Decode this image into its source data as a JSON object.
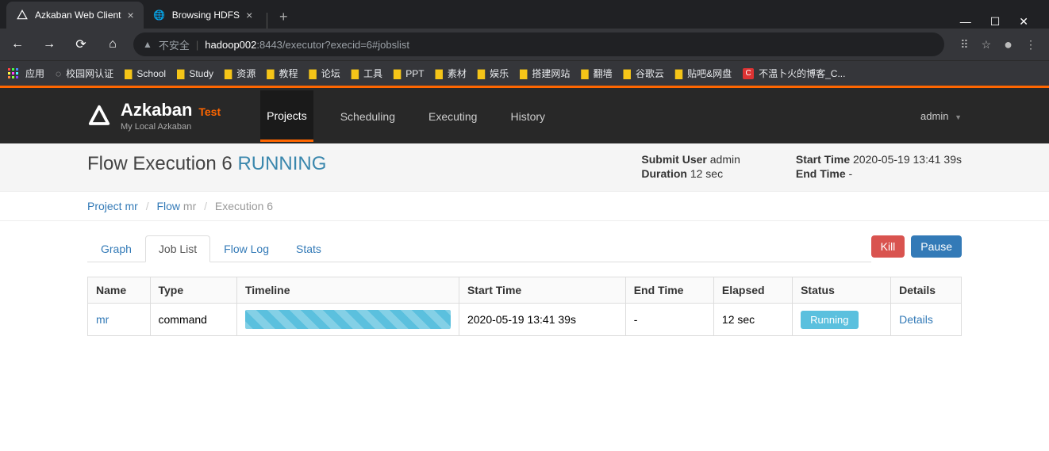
{
  "browser": {
    "tabs": [
      {
        "title": "Azkaban Web Client",
        "active": true
      },
      {
        "title": "Browsing HDFS",
        "active": false
      }
    ],
    "url_insecure_label": "不安全",
    "url_host": "hadoop002",
    "url_port": ":8443",
    "url_path": "/executor?execid=6#jobslist",
    "bookmarks_label_apps": "应用",
    "bookmarks": [
      {
        "label": "校园网认证",
        "icon": "globe"
      },
      {
        "label": "School",
        "icon": "folder"
      },
      {
        "label": "Study",
        "icon": "folder"
      },
      {
        "label": "资源",
        "icon": "folder"
      },
      {
        "label": "教程",
        "icon": "folder"
      },
      {
        "label": "论坛",
        "icon": "folder"
      },
      {
        "label": "工具",
        "icon": "folder"
      },
      {
        "label": "PPT",
        "icon": "folder"
      },
      {
        "label": "素材",
        "icon": "folder"
      },
      {
        "label": "娱乐",
        "icon": "folder"
      },
      {
        "label": "搭建网站",
        "icon": "folder"
      },
      {
        "label": "翻墙",
        "icon": "folder"
      },
      {
        "label": "谷歌云",
        "icon": "folder"
      },
      {
        "label": "贴吧&网盘",
        "icon": "folder"
      },
      {
        "label": "不温卜火的博客_C...",
        "icon": "red"
      }
    ]
  },
  "az": {
    "brand": "Azkaban",
    "brand_sub": "Test",
    "tagline": "My Local Azkaban",
    "menu": {
      "projects": "Projects",
      "scheduling": "Scheduling",
      "executing": "Executing",
      "history": "History"
    },
    "user": "admin"
  },
  "page": {
    "title_prefix": "Flow Execution ",
    "exec_id": "6",
    "status": "RUNNING",
    "meta": {
      "submit_user_label": "Submit User",
      "submit_user": "admin",
      "duration_label": "Duration",
      "duration": "12 sec",
      "start_time_label": "Start Time",
      "start_time": "2020-05-19 13:41 39s",
      "end_time_label": "End Time",
      "end_time": "-"
    }
  },
  "breadcrumb": {
    "project_label": "Project",
    "project_name": "mr",
    "flow_label": "Flow",
    "flow_name": "mr",
    "execution_label": "Execution",
    "execution_id": "6"
  },
  "tabs": {
    "graph": "Graph",
    "job_list": "Job List",
    "flow_log": "Flow Log",
    "stats": "Stats"
  },
  "buttons": {
    "kill": "Kill",
    "pause": "Pause"
  },
  "table": {
    "headers": {
      "name": "Name",
      "type": "Type",
      "timeline": "Timeline",
      "start_time": "Start Time",
      "end_time": "End Time",
      "elapsed": "Elapsed",
      "status": "Status",
      "details": "Details"
    },
    "rows": [
      {
        "name": "mr",
        "type": "command",
        "start_time": "2020-05-19 13:41 39s",
        "end_time": "-",
        "elapsed": "12 sec",
        "status": "Running",
        "details": "Details"
      }
    ]
  }
}
